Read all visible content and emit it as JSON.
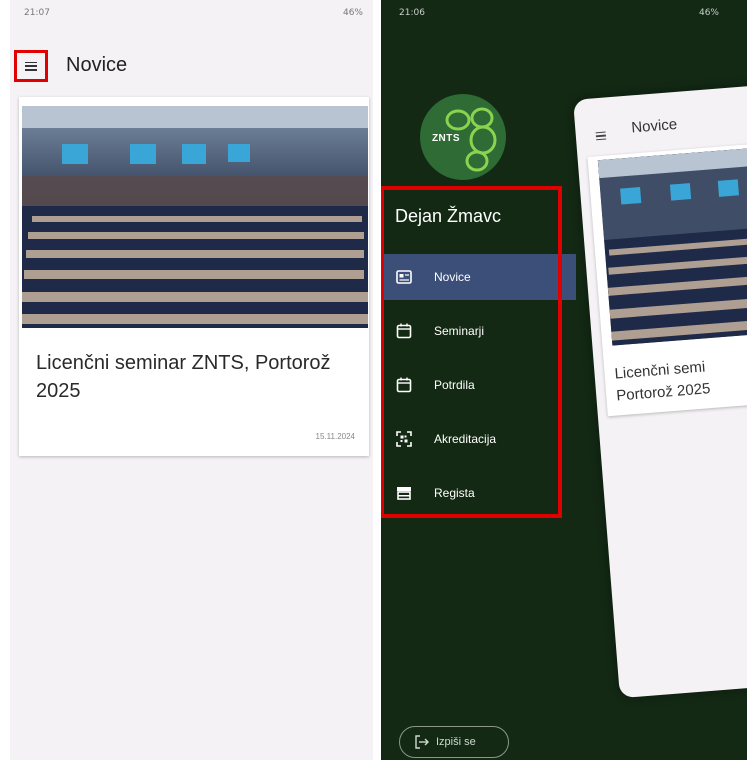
{
  "left_screen": {
    "status": {
      "time": "21:07",
      "indicators": "46%"
    },
    "appbar": {
      "title": "Novice",
      "menu_icon": "menu-icon"
    },
    "news_card": {
      "title": "Licenčni seminar ZNTS, Portorož 2025",
      "date": "15.11.2024"
    }
  },
  "right_screen": {
    "status": {
      "time": "21:06",
      "indicators": "46%"
    },
    "logo_text": "ZNTS",
    "user_name": "Dejan Žmavc",
    "menu": [
      {
        "label": "Novice",
        "icon": "news-icon",
        "active": true
      },
      {
        "label": "Seminarji",
        "icon": "calendar-icon",
        "active": false
      },
      {
        "label": "Potrdila",
        "icon": "calendar-icon",
        "active": false
      },
      {
        "label": "Akreditacija",
        "icon": "qr-scan-icon",
        "active": false
      },
      {
        "label": "Regista",
        "icon": "store-icon",
        "active": false
      }
    ],
    "logout_label": "Izpiši se",
    "preview": {
      "title": "Novice",
      "card_text_line1": "Licenčni semi",
      "card_text_line2": "Portorož 2025"
    }
  },
  "colors": {
    "drawer_bg": "#132914",
    "active_item": "#3c4f79",
    "highlight": "#e00000",
    "logo": "#2e6b35"
  }
}
